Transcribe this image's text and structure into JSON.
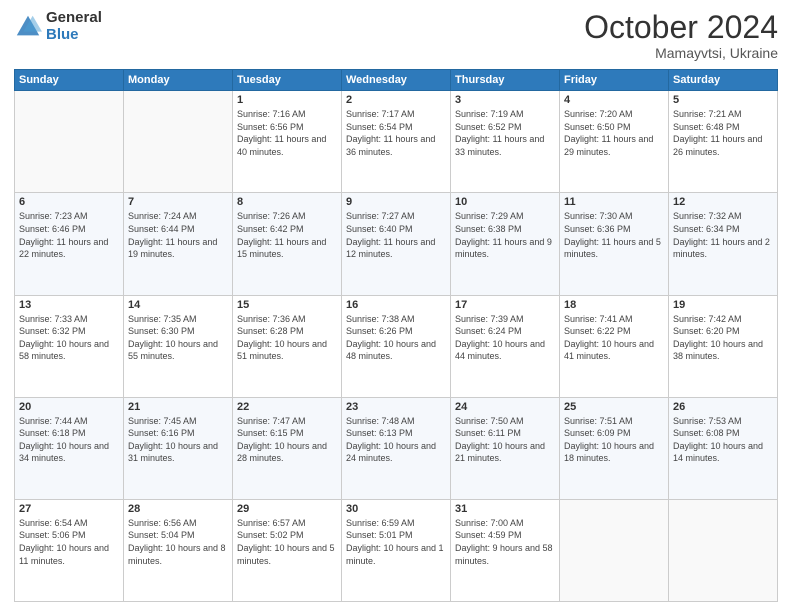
{
  "header": {
    "logo_general": "General",
    "logo_blue": "Blue",
    "month_title": "October 2024",
    "subtitle": "Mamayvtsi, Ukraine"
  },
  "weekdays": [
    "Sunday",
    "Monday",
    "Tuesday",
    "Wednesday",
    "Thursday",
    "Friday",
    "Saturday"
  ],
  "weeks": [
    [
      {
        "day": "",
        "sunrise": "",
        "sunset": "",
        "daylight": ""
      },
      {
        "day": "",
        "sunrise": "",
        "sunset": "",
        "daylight": ""
      },
      {
        "day": "1",
        "sunrise": "Sunrise: 7:16 AM",
        "sunset": "Sunset: 6:56 PM",
        "daylight": "Daylight: 11 hours and 40 minutes."
      },
      {
        "day": "2",
        "sunrise": "Sunrise: 7:17 AM",
        "sunset": "Sunset: 6:54 PM",
        "daylight": "Daylight: 11 hours and 36 minutes."
      },
      {
        "day": "3",
        "sunrise": "Sunrise: 7:19 AM",
        "sunset": "Sunset: 6:52 PM",
        "daylight": "Daylight: 11 hours and 33 minutes."
      },
      {
        "day": "4",
        "sunrise": "Sunrise: 7:20 AM",
        "sunset": "Sunset: 6:50 PM",
        "daylight": "Daylight: 11 hours and 29 minutes."
      },
      {
        "day": "5",
        "sunrise": "Sunrise: 7:21 AM",
        "sunset": "Sunset: 6:48 PM",
        "daylight": "Daylight: 11 hours and 26 minutes."
      }
    ],
    [
      {
        "day": "6",
        "sunrise": "Sunrise: 7:23 AM",
        "sunset": "Sunset: 6:46 PM",
        "daylight": "Daylight: 11 hours and 22 minutes."
      },
      {
        "day": "7",
        "sunrise": "Sunrise: 7:24 AM",
        "sunset": "Sunset: 6:44 PM",
        "daylight": "Daylight: 11 hours and 19 minutes."
      },
      {
        "day": "8",
        "sunrise": "Sunrise: 7:26 AM",
        "sunset": "Sunset: 6:42 PM",
        "daylight": "Daylight: 11 hours and 15 minutes."
      },
      {
        "day": "9",
        "sunrise": "Sunrise: 7:27 AM",
        "sunset": "Sunset: 6:40 PM",
        "daylight": "Daylight: 11 hours and 12 minutes."
      },
      {
        "day": "10",
        "sunrise": "Sunrise: 7:29 AM",
        "sunset": "Sunset: 6:38 PM",
        "daylight": "Daylight: 11 hours and 9 minutes."
      },
      {
        "day": "11",
        "sunrise": "Sunrise: 7:30 AM",
        "sunset": "Sunset: 6:36 PM",
        "daylight": "Daylight: 11 hours and 5 minutes."
      },
      {
        "day": "12",
        "sunrise": "Sunrise: 7:32 AM",
        "sunset": "Sunset: 6:34 PM",
        "daylight": "Daylight: 11 hours and 2 minutes."
      }
    ],
    [
      {
        "day": "13",
        "sunrise": "Sunrise: 7:33 AM",
        "sunset": "Sunset: 6:32 PM",
        "daylight": "Daylight: 10 hours and 58 minutes."
      },
      {
        "day": "14",
        "sunrise": "Sunrise: 7:35 AM",
        "sunset": "Sunset: 6:30 PM",
        "daylight": "Daylight: 10 hours and 55 minutes."
      },
      {
        "day": "15",
        "sunrise": "Sunrise: 7:36 AM",
        "sunset": "Sunset: 6:28 PM",
        "daylight": "Daylight: 10 hours and 51 minutes."
      },
      {
        "day": "16",
        "sunrise": "Sunrise: 7:38 AM",
        "sunset": "Sunset: 6:26 PM",
        "daylight": "Daylight: 10 hours and 48 minutes."
      },
      {
        "day": "17",
        "sunrise": "Sunrise: 7:39 AM",
        "sunset": "Sunset: 6:24 PM",
        "daylight": "Daylight: 10 hours and 44 minutes."
      },
      {
        "day": "18",
        "sunrise": "Sunrise: 7:41 AM",
        "sunset": "Sunset: 6:22 PM",
        "daylight": "Daylight: 10 hours and 41 minutes."
      },
      {
        "day": "19",
        "sunrise": "Sunrise: 7:42 AM",
        "sunset": "Sunset: 6:20 PM",
        "daylight": "Daylight: 10 hours and 38 minutes."
      }
    ],
    [
      {
        "day": "20",
        "sunrise": "Sunrise: 7:44 AM",
        "sunset": "Sunset: 6:18 PM",
        "daylight": "Daylight: 10 hours and 34 minutes."
      },
      {
        "day": "21",
        "sunrise": "Sunrise: 7:45 AM",
        "sunset": "Sunset: 6:16 PM",
        "daylight": "Daylight: 10 hours and 31 minutes."
      },
      {
        "day": "22",
        "sunrise": "Sunrise: 7:47 AM",
        "sunset": "Sunset: 6:15 PM",
        "daylight": "Daylight: 10 hours and 28 minutes."
      },
      {
        "day": "23",
        "sunrise": "Sunrise: 7:48 AM",
        "sunset": "Sunset: 6:13 PM",
        "daylight": "Daylight: 10 hours and 24 minutes."
      },
      {
        "day": "24",
        "sunrise": "Sunrise: 7:50 AM",
        "sunset": "Sunset: 6:11 PM",
        "daylight": "Daylight: 10 hours and 21 minutes."
      },
      {
        "day": "25",
        "sunrise": "Sunrise: 7:51 AM",
        "sunset": "Sunset: 6:09 PM",
        "daylight": "Daylight: 10 hours and 18 minutes."
      },
      {
        "day": "26",
        "sunrise": "Sunrise: 7:53 AM",
        "sunset": "Sunset: 6:08 PM",
        "daylight": "Daylight: 10 hours and 14 minutes."
      }
    ],
    [
      {
        "day": "27",
        "sunrise": "Sunrise: 6:54 AM",
        "sunset": "Sunset: 5:06 PM",
        "daylight": "Daylight: 10 hours and 11 minutes."
      },
      {
        "day": "28",
        "sunrise": "Sunrise: 6:56 AM",
        "sunset": "Sunset: 5:04 PM",
        "daylight": "Daylight: 10 hours and 8 minutes."
      },
      {
        "day": "29",
        "sunrise": "Sunrise: 6:57 AM",
        "sunset": "Sunset: 5:02 PM",
        "daylight": "Daylight: 10 hours and 5 minutes."
      },
      {
        "day": "30",
        "sunrise": "Sunrise: 6:59 AM",
        "sunset": "Sunset: 5:01 PM",
        "daylight": "Daylight: 10 hours and 1 minute."
      },
      {
        "day": "31",
        "sunrise": "Sunrise: 7:00 AM",
        "sunset": "Sunset: 4:59 PM",
        "daylight": "Daylight: 9 hours and 58 minutes."
      },
      {
        "day": "",
        "sunrise": "",
        "sunset": "",
        "daylight": ""
      },
      {
        "day": "",
        "sunrise": "",
        "sunset": "",
        "daylight": ""
      }
    ]
  ]
}
